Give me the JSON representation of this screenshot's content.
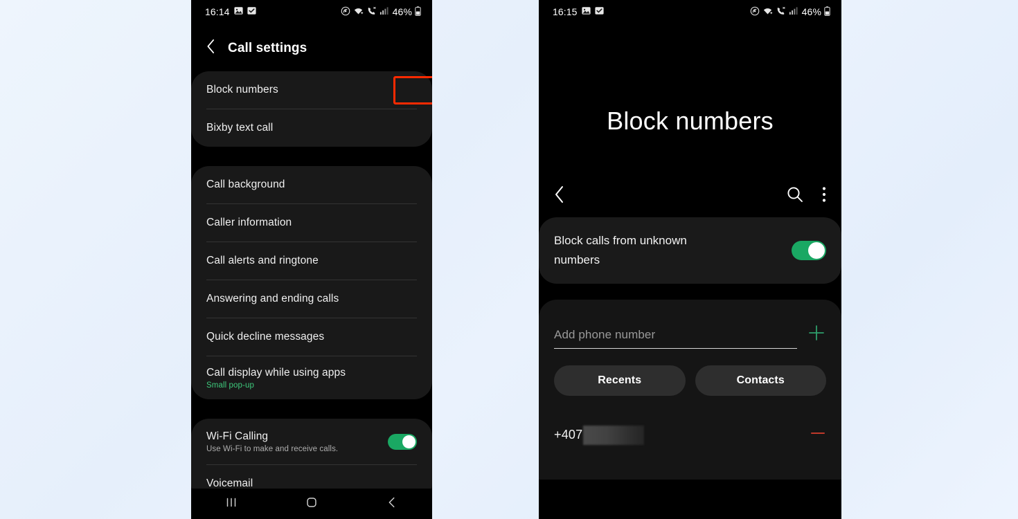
{
  "background": {
    "accent_red": "#ff2a00",
    "accent_green": "#1aa863",
    "sub_green": "#3ec97c"
  },
  "left_phone": {
    "status_bar": {
      "time": "16:14",
      "battery_percent": "46%",
      "icons": [
        "gallery-icon",
        "checkbox-icon",
        "nfc-icon",
        "wifi-icon",
        "call-vpn-icon",
        "signal-icon",
        "battery-icon"
      ]
    },
    "header": {
      "back_icon": "chevron-left-icon",
      "title": "Call settings"
    },
    "groups": [
      {
        "items": [
          {
            "label": "Block numbers",
            "highlighted": true
          },
          {
            "label": "Bixby text call"
          }
        ]
      },
      {
        "items": [
          {
            "label": "Call background"
          },
          {
            "label": "Caller information"
          },
          {
            "label": "Call alerts and ringtone"
          },
          {
            "label": "Answering and ending calls"
          },
          {
            "label": "Quick decline messages"
          },
          {
            "label": "Call display while using apps",
            "sub": "Small pop-up"
          }
        ]
      },
      {
        "items": [
          {
            "label": "Wi-Fi Calling",
            "sub_grey": "Use Wi-Fi to make and receive calls.",
            "toggle": "on"
          },
          {
            "label": "Voicemail"
          }
        ]
      }
    ],
    "navbar": {
      "recents": "recents-icon",
      "home": "home-icon",
      "back": "back-icon"
    }
  },
  "right_phone": {
    "status_bar": {
      "time": "16:15",
      "battery_percent": "46%"
    },
    "title": "Block numbers",
    "toolbar": {
      "back_icon": "chevron-left-icon",
      "search_icon": "search-icon",
      "more_icon": "more-vertical-icon"
    },
    "block_unknown": {
      "label": "Block calls from unknown numbers",
      "toggle": "on"
    },
    "add_number": {
      "placeholder": "Add phone number",
      "value": "",
      "add_icon": "plus-icon"
    },
    "chips": [
      {
        "label": "Recents"
      },
      {
        "label": "Contacts"
      }
    ],
    "blocked_list": [
      {
        "number_prefix": "+407",
        "redacted": true,
        "remove_icon": "minus-icon"
      }
    ]
  }
}
